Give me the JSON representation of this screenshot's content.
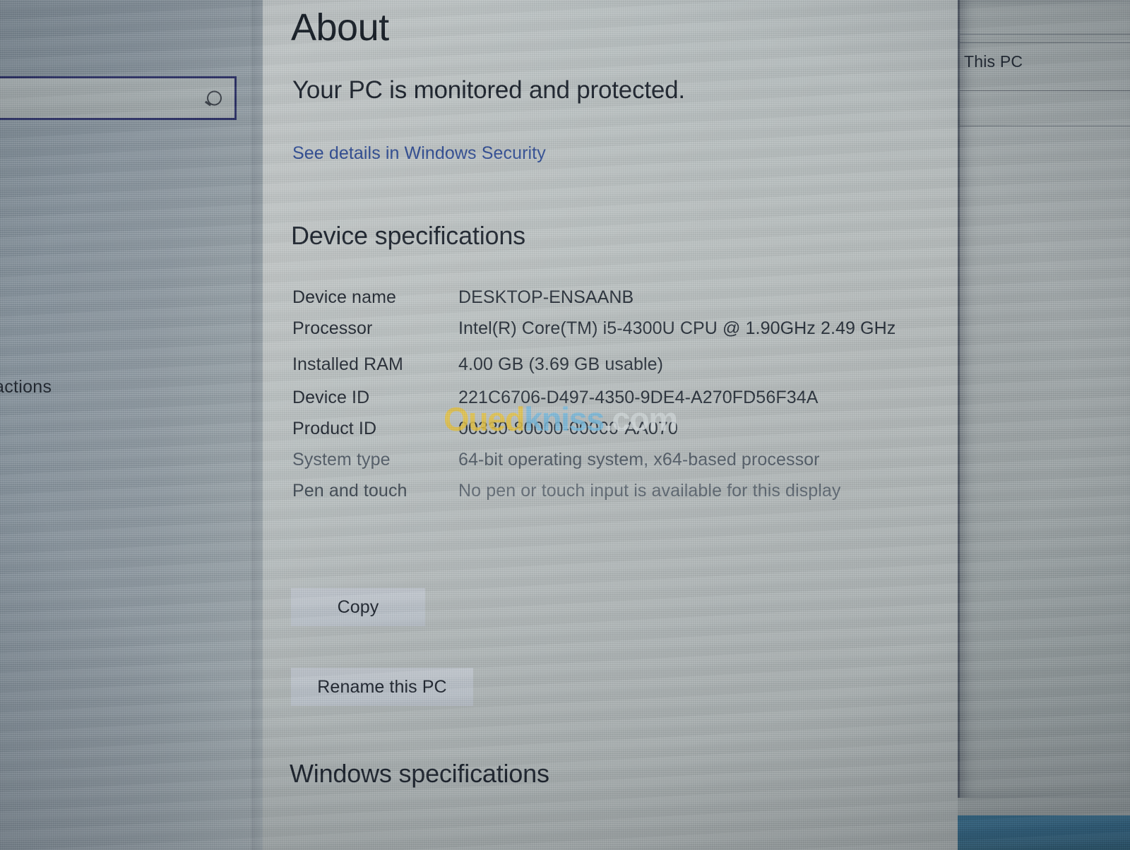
{
  "window": {
    "app_title": "About",
    "status_line": "Your PC is monitored and protected.",
    "security_link": "See details in Windows Security"
  },
  "nav": {
    "search_value": "",
    "search_placeholder": "",
    "search_icon": "search-icon",
    "partial_item_text": "actions"
  },
  "sections": {
    "device_specifications": "Device specifications",
    "windows_specifications": "Windows specifications"
  },
  "device_specs": [
    {
      "label": "Device name",
      "value": "DESKTOP-ENSAANB"
    },
    {
      "label": "Processor",
      "value": "Intel(R) Core(TM) i5-4300U CPU @ 1.90GHz   2.49 GHz"
    },
    {
      "label": "Installed RAM",
      "value": "4.00 GB (3.69 GB usable)"
    },
    {
      "label": "Device ID",
      "value": "221C6706-D497-4350-9DE4-A270FD56F34A"
    },
    {
      "label": "Product ID",
      "value": "00330-80000-00000-AA070"
    },
    {
      "label": "System type",
      "value": "64-bit operating system, x64-based processor"
    },
    {
      "label": "Pen and touch",
      "value": "No pen or touch input is available for this display"
    }
  ],
  "buttons": {
    "copy": "Copy",
    "rename_pc": "Rename this PC"
  },
  "background_window": {
    "this_pc": "This PC"
  },
  "watermark": {
    "part1": "Oued",
    "part2": "kniss",
    "part3": ".com"
  },
  "colors": {
    "link": "#2d4a91",
    "heading_text": "#1a212b",
    "body_text": "#232b35",
    "search_border": "#2a2f63",
    "watermark_gold": "#e3bf3d",
    "watermark_blue": "#72b6da",
    "watermark_gray": "#cfd6d8",
    "taskbar_blue": "#2d6383",
    "nav_pane_bg": "#96a0a6",
    "content_pane_bg": "#b3babb"
  }
}
